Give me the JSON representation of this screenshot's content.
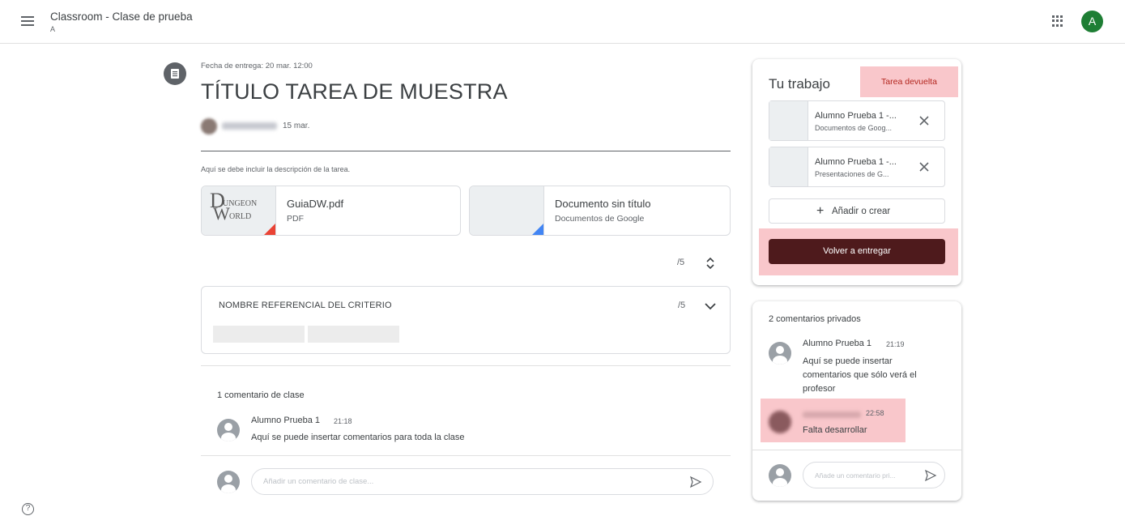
{
  "header": {
    "title": "Classroom - Clase de prueba",
    "subtitle": "A",
    "account_initial": "A",
    "account_color": "#1e7e34"
  },
  "assignment": {
    "due": "Fecha de entrega: 20 mar. 12:00",
    "title": "TÍTULO TAREA DE MUESTRA",
    "post_date": "15 mar.",
    "description": "Aquí se debe incluir la descripción de la tarea.",
    "attachments": [
      {
        "name": "GuiaDW.pdf",
        "type": "PDF",
        "logo_top": "UNGEON",
        "logo_bottom": "ORLD",
        "color": "#ea4335"
      },
      {
        "name": "Documento sin título",
        "type": "Documentos de Google",
        "color": "#4285f4"
      }
    ],
    "points": "/5"
  },
  "rubric": {
    "criterion": "NOMBRE REFERENCIAL DEL CRITERIO",
    "points": "/5"
  },
  "class_comments": {
    "count_label": "1 comentario de clase",
    "items": [
      {
        "author": "Alumno Prueba 1",
        "time": "21:18",
        "text": "Aquí se puede insertar comentarios para toda la clase"
      }
    ],
    "input_placeholder": "Añadir un comentario de clase..."
  },
  "your_work": {
    "title": "Tu trabajo",
    "status": "Tarea devuelta",
    "files": [
      {
        "name": "Alumno Prueba 1 -...",
        "type": "Documentos de Goog..."
      },
      {
        "name": "Alumno Prueba 1 -...",
        "type": "Presentaciones de G..."
      }
    ],
    "add_label": "Añadir o crear",
    "resubmit_label": "Volver a entregar"
  },
  "private_comments": {
    "count_label": "2 comentarios privados",
    "items": [
      {
        "author": "Alumno Prueba 1",
        "time": "21:19",
        "text": "Aquí se puede insertar comentarios que sólo verá el profesor"
      },
      {
        "time": "22:58",
        "text": "Falta desarrollar"
      }
    ],
    "input_placeholder": "Añade un comentario pri..."
  },
  "colors": {
    "highlight": "#f9c7cb",
    "resubmit": "#4e1a1c",
    "status_text": "#b3261e"
  }
}
